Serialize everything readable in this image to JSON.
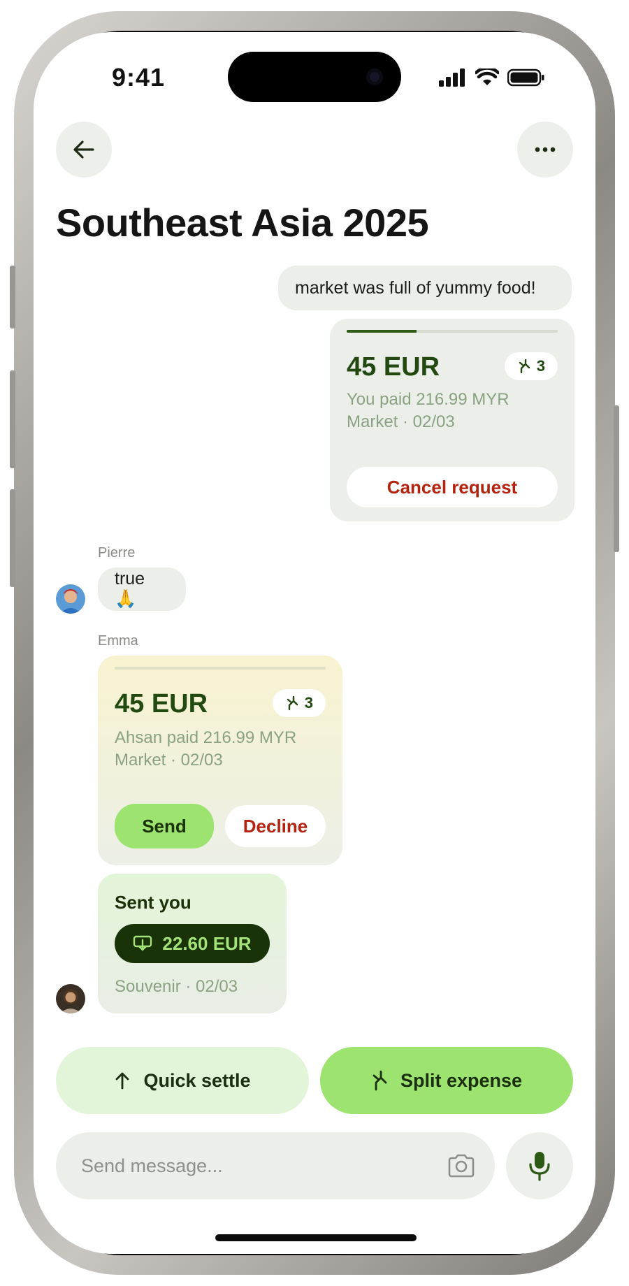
{
  "status_bar": {
    "time": "9:41"
  },
  "header": {
    "title": "Southeast Asia 2025",
    "back_icon": "arrow-left-icon",
    "more_icon": "more-horizontal-icon"
  },
  "messages": {
    "own_text": "market was full of yummy food!",
    "own_request": {
      "amount": "45 EUR",
      "split_count": "3",
      "progress": 0.33,
      "detail_line1": "You paid 216.99 MYR",
      "detail_line2": "Market · 02/03",
      "cancel_label": "Cancel request"
    },
    "pierre": {
      "name": "Pierre",
      "text": "true 🙏"
    },
    "emma": {
      "name": "Emma"
    },
    "incoming_request": {
      "amount": "45 EUR",
      "split_count": "3",
      "progress": 0.0,
      "detail_line1": "Ahsan paid 216.99 MYR",
      "detail_line2": "Market · 02/03",
      "send_label": "Send",
      "decline_label": "Decline"
    },
    "payment": {
      "heading": "Sent you",
      "amount": "22.60 EUR",
      "note": "Souvenir · 02/03"
    }
  },
  "actions": {
    "quick_settle": "Quick settle",
    "split_expense": "Split expense"
  },
  "composer": {
    "placeholder": "Send message..."
  },
  "colors": {
    "accent_green": "#9de36f",
    "light_green": "#e3f5d8",
    "dark_green": "#1a3208",
    "danger_red": "#b3230f",
    "bubble_gray": "#eceeea"
  }
}
